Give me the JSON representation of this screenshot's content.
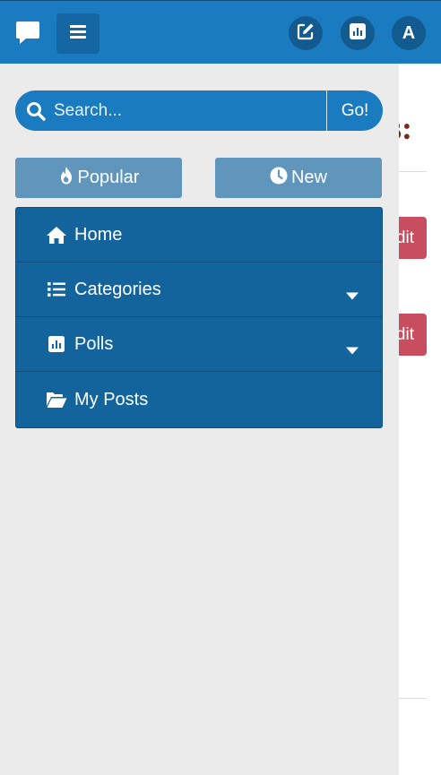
{
  "header": {
    "logo_icon": "chat-bubble-icon",
    "menu_icon": "hamburger-icon",
    "compose_icon": "edit-icon",
    "stats_icon": "bar-chart-icon",
    "avatar_letter": "A"
  },
  "background": {
    "title_fragment": "s:",
    "edit_label_1": "dit",
    "edit_label_2": "dit"
  },
  "drawer": {
    "search": {
      "placeholder": "Search...",
      "go_label": "Go!"
    },
    "segments": [
      {
        "label": "Popular",
        "icon": "fire-icon"
      },
      {
        "label": "New",
        "icon": "clock-icon"
      }
    ],
    "menu": [
      {
        "label": "Home",
        "icon": "home-icon"
      },
      {
        "label": "Categories",
        "icon": "list-icon",
        "dropdown": true
      },
      {
        "label": "Polls",
        "icon": "poll-icon",
        "dropdown": true
      },
      {
        "label": "My Posts",
        "icon": "folder-open-icon"
      }
    ]
  },
  "colors": {
    "header": "#1a7bc0",
    "drawer_bg": "#ebebeb",
    "menu_bg": "#13639c",
    "segment_bg": "#6096bc",
    "edit_button": "#c84d5e"
  }
}
